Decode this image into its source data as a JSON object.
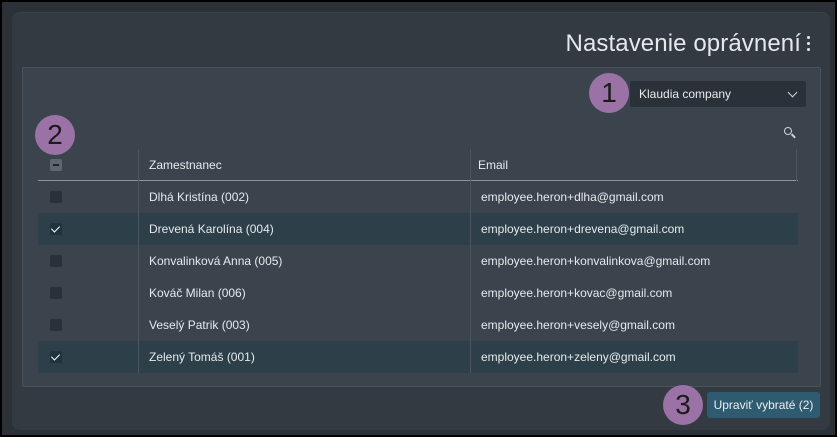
{
  "header": {
    "title": "Nastavenie oprávnení"
  },
  "company_select": {
    "value": "Klaudia company"
  },
  "steps": {
    "one": "1",
    "two": "2",
    "three": "3"
  },
  "table": {
    "columns": [
      "Zamestnanec",
      "Email"
    ],
    "rows": [
      {
        "name": "Dlhá Kristína (002)",
        "email": "employee.heron+dlha@gmail.com",
        "checked": false
      },
      {
        "name": "Drevená Karolína (004)",
        "email": "employee.heron+drevena@gmail.com",
        "checked": true
      },
      {
        "name": "Konvalinková Anna (005)",
        "email": "employee.heron+konvalinkova@gmail.com",
        "checked": false
      },
      {
        "name": "Kováč Milan (006)",
        "email": "employee.heron+kovac@gmail.com",
        "checked": false
      },
      {
        "name": "Veselý Patrik (003)",
        "email": "employee.heron+vesely@gmail.com",
        "checked": false
      },
      {
        "name": "Zelený Tomáš (001)",
        "email": "employee.heron+zeleny@gmail.com",
        "checked": true
      }
    ]
  },
  "actions": {
    "edit_selected": "Upraviť vybraté (2)"
  },
  "colors": {
    "accent": "#9b72a6",
    "button": "#2e5b70",
    "selected_row": "#2d4049"
  },
  "icons": [
    "kebab-menu-icon",
    "chevron-down-icon",
    "search-icon",
    "checkmark-icon"
  ]
}
